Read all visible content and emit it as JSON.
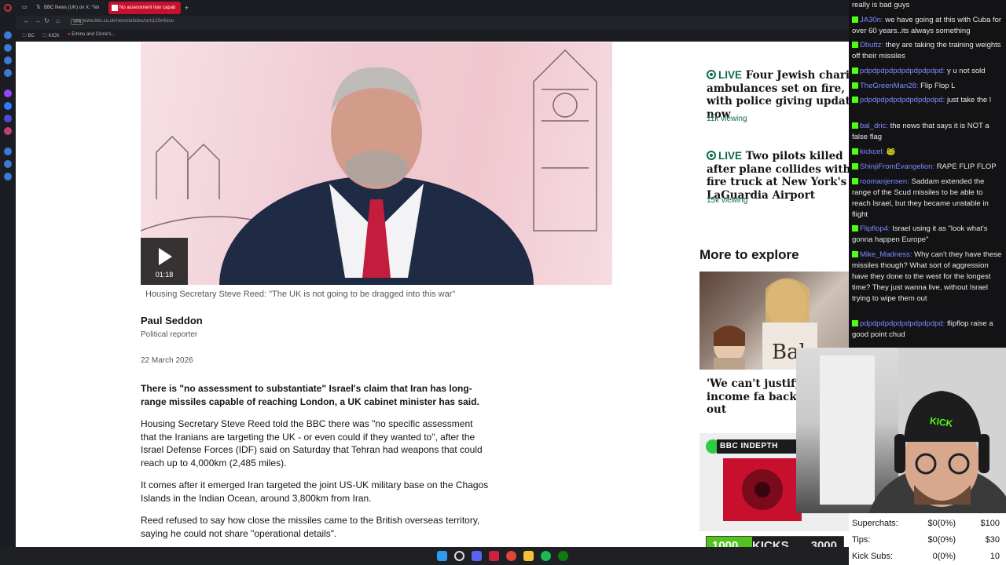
{
  "browser": {
    "tabs": [
      {
        "label": "BBC News (UK) on X: \"No",
        "active": false
      },
      {
        "label": "No assessment Iran capab",
        "active": true
      }
    ],
    "vpn_label": "VPN",
    "url": "www.bbc.co.uk/news/articles/crm120x4lzxo",
    "bookmarks": [
      "BC",
      "KICK",
      "Eminu and Cinne's..."
    ]
  },
  "article": {
    "video_duration": "01:18",
    "caption": "Housing Secretary Steve Reed: \"The UK is not going to be dragged into this war\"",
    "author": "Paul Seddon",
    "author_role": "Political reporter",
    "date": "22 March 2026",
    "paragraphs": [
      "There is \"no assessment to substantiate\" Israel's claim that Iran has long-range missiles capable of reaching London, a UK cabinet minister has said.",
      "Housing Secretary Steve Reed told the BBC there was \"no specific assessment that the Iranians are targeting the UK - or even could if they wanted to\", after the Israel Defense Forces (IDF) said on Saturday that Tehran had weapons that could reach up to 4,000km (2,485 miles).",
      "It comes after it emerged Iran targeted the joint US-UK military base on the Chagos Islands in the Indian Ocean, around 3,800km from Iran.",
      "Reed refused to say how close the missiles came to the British overseas territory, saying he could not share \"operational details\"."
    ]
  },
  "sidebar": {
    "live_tag": "LIVE",
    "live_items": [
      {
        "title": "Four Jewish charity ambulances set on fire, with police giving update now",
        "viewing": "11k viewing"
      },
      {
        "title": "Two pilots killed after plane collides with fire truck at New York's LaGuardia Airport",
        "viewing": "15k viewing"
      }
    ],
    "explore_heading": "More to explore",
    "explore_item_title": "'We can't justify a Middle-income fa back on days out",
    "explore_img_text": "Bala",
    "indepth_label": "BBC INDEPTH"
  },
  "chat": [
    {
      "user": "",
      "text": "really is bad guys"
    },
    {
      "user": "JA30n:",
      "text": "we have going at this with Cuba for over 60 years..its always something"
    },
    {
      "user": "Dbuttz:",
      "text": "they are taking the training weights off their missiles"
    },
    {
      "user": "pdpdpdpdpdpdpdpdpdpd:",
      "text": "y u not sold"
    },
    {
      "user": "TheGreenMan28:",
      "text": "Flip Flop L"
    },
    {
      "user": "pdpdpdpdpdpdpdpdpdpd:",
      "text": "just take the l"
    },
    {
      "user": "bal_dric:",
      "text": "the news that says it is NOT a false flag"
    },
    {
      "user": "kickcel:",
      "text": "🐸"
    },
    {
      "user": "ShinjiFromEvangelion:",
      "text": "RAPE FLIP FLOP"
    },
    {
      "user": "roomanjensen:",
      "text": "Saddam extended the range of the Scud missiles to be able to reach Israel, but they became unstable in flight"
    },
    {
      "user": "Flipflop4:",
      "text": "Israel using it as \"look what's gonna happen Europe\""
    },
    {
      "user": "Mike_Madness:",
      "text": "Why can't they have these missiles though? What sort of aggression have they done to the west for the longest time? They just wanna live, without Israel trying to wipe them out"
    },
    {
      "user": "pdpdpdpdpdpdpdpdpdpd:",
      "text": "flipflop raise a good point chud"
    }
  ],
  "webcam": {
    "cap_text": "KICK"
  },
  "stats": {
    "rows": [
      {
        "label": "Superchats:",
        "value": "$0(0%)",
        "goal": "$100"
      },
      {
        "label": "Tips:",
        "value": "$0(0%)",
        "goal": "$30"
      },
      {
        "label": "Kick Subs:",
        "value": "0(0%)",
        "goal": "10"
      }
    ]
  },
  "kicks_bar": {
    "current": "1000",
    "label": "KICKS",
    "goal": "3000",
    "progress": 0.333
  },
  "colors": {
    "bbc_live": "#116a4f",
    "kick_green": "#53fc18",
    "chat_user": "#7a8cff"
  }
}
